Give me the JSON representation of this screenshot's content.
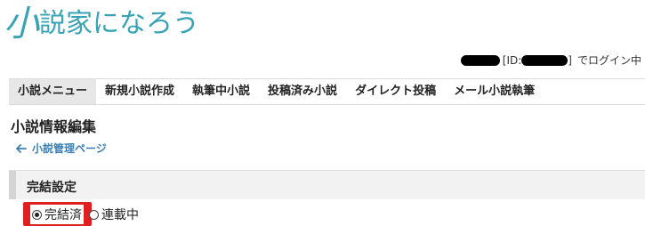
{
  "logo": {
    "mark": "小",
    "text": "説家になろう"
  },
  "user": {
    "id_prefix": "[ID:",
    "id_suffix": "]",
    "login_text": "でログイン中"
  },
  "nav": {
    "items": [
      {
        "label": "小説メニュー",
        "active": true
      },
      {
        "label": "新規小説作成"
      },
      {
        "label": "執筆中小説"
      },
      {
        "label": "投稿済み小説"
      },
      {
        "label": "ダイレクト投稿"
      },
      {
        "label": "メール小説執筆"
      }
    ]
  },
  "page": {
    "title": "小説情報編集",
    "back_link": "小説管理ページ"
  },
  "section": {
    "title": "完結設定"
  },
  "options": {
    "completed": {
      "label": "完結済",
      "checked": true
    },
    "ongoing": {
      "label": "連載中",
      "checked": false
    }
  },
  "colors": {
    "brand": "#39a3b6",
    "link": "#3b7fb7",
    "highlight": "#e02020"
  }
}
